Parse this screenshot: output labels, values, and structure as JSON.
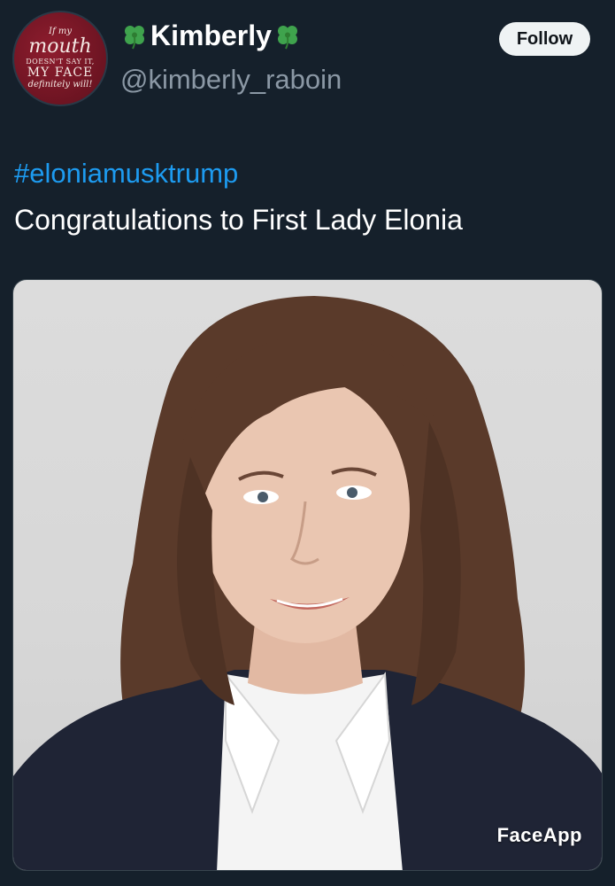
{
  "tweet": {
    "author": {
      "display_name": "Kimberly",
      "handle": "@kimberly_raboin",
      "name_emoji": "four-leaf-clover-icon",
      "avatar": {
        "line1": "If my",
        "line2": "mouth",
        "line3": "DOESN'T SAY IT,",
        "line4": "MY FACE",
        "line5": "definitely will!"
      }
    },
    "follow_label": "Follow",
    "hashtag": "#eloniamusktrump",
    "text": "Congratulations to First Lady Elonia",
    "media": {
      "watermark": "FaceApp"
    }
  },
  "colors": {
    "background": "#15202b",
    "link": "#1d9bf0",
    "secondary_text": "#8b98a5",
    "avatar_bg": "#6d1422",
    "clover": "#3fa34d"
  }
}
